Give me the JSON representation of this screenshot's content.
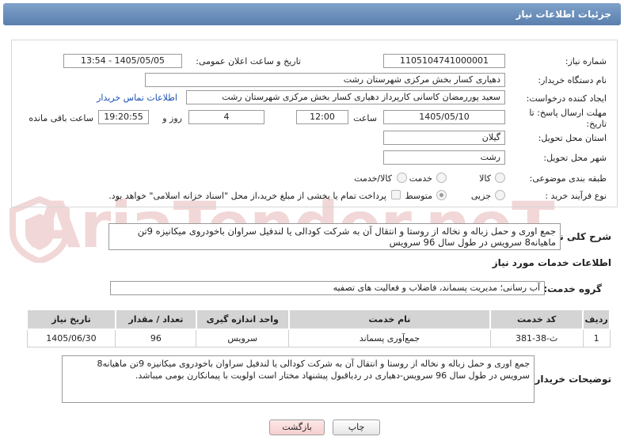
{
  "header": {
    "title": "جزئیات اطلاعات نیاز"
  },
  "watermark": "AriaTender.neT",
  "fields": {
    "need_number_label": "شماره نیاز:",
    "need_number": "1105104741000001",
    "announce_label": "تاریخ و ساعت اعلان عمومی:",
    "announce_value": "1405/05/05 - 13:54",
    "buyer_org_label": "نام دستگاه خریدار:",
    "buyer_org": "دهیاری کسار بخش مرکزی شهرستان رشت",
    "creator_label": "ایجاد کننده درخواست:",
    "creator": "سعید پوررمضان کاسانی کارپرداز دهیاری کسار بخش مرکزی شهرستان رشت",
    "contact_link": "اطلاعات تماس خریدار",
    "deadline_label": "مهلت ارسال پاسخ: تا تاریخ:",
    "deadline_date": "1405/05/10",
    "time_label": "ساعت",
    "deadline_time": "12:00",
    "days_value": "4",
    "days_label": "روز و",
    "remaining_time": "19:20:55",
    "remaining_label": "ساعت باقی مانده",
    "province_label": "استان محل تحویل:",
    "province": "گیلان",
    "city_label": "شهر محل تحویل:",
    "city": "رشت",
    "category_label": "طبقه بندی موضوعی:",
    "category_options": [
      "کالا",
      "خدمت",
      "کالا/خدمت"
    ],
    "process_label": "نوع فرآیند خرید :",
    "process_options": [
      "جزیی",
      "متوسط"
    ],
    "payment_note": "پرداخت تمام یا بخشی از مبلغ خرید،از محل \"اسناد خزانه اسلامی\" خواهد بود."
  },
  "summary": {
    "label": "شرح کلی نیاز:",
    "text": "جمع اوری و حمل زباله و نخاله از روستا و انتقال آن به شرکت کودالی یا لندفیل سراوان باخودروی میکانیزه 9تن ماهیانه8 سرویس در طول سال 96 سرویس"
  },
  "services": {
    "section_title": "اطلاعات خدمات مورد نیاز",
    "group_label": "گروه خدمت:",
    "group_value": "آب رسانی؛ مدیریت پسماند، فاضلاب و فعالیت های تصفیه",
    "table": {
      "headers": [
        "ردیف",
        "کد خدمت",
        "نام خدمت",
        "واحد اندازه گیری",
        "تعداد / مقدار",
        "تاریخ نیاز"
      ],
      "rows": [
        [
          "1",
          "ث-38-381",
          "جمع‌آوری پسماند",
          "سرویس",
          "96",
          "1405/06/30"
        ]
      ]
    }
  },
  "buyer_notes": {
    "label": "توضیحات خریدار:",
    "text": "جمع اوری و حمل زباله و نخاله از روستا و انتقال آن به شرکت کودالی یا لندفیل سراوان باخودروی میکانیزه 9تن ماهیانه8 سرویس در طول سال 96 سرویس-دهیاری در ردیاقبول پیشنهاد مختار است اولویت با پیمانکارن بومی میباشد."
  },
  "buttons": {
    "print": "چاپ",
    "back": "بازگشت"
  },
  "colors": {
    "header": "#6a8fbc",
    "link": "#1a4fb0",
    "back_button": "#f6cfcf"
  }
}
